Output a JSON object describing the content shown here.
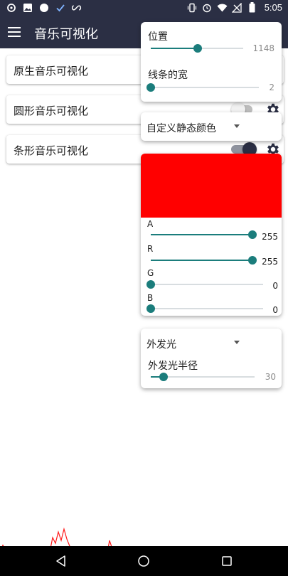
{
  "status_bar": {
    "time": "5:05",
    "left_icons": [
      "sync-icon",
      "image-icon",
      "circle-icon",
      "check-icon",
      "infinity-icon"
    ],
    "right_icons": [
      "vibrate-icon",
      "alarm-icon",
      "wifi-icon",
      "no-signal-icon",
      "battery-icon"
    ]
  },
  "app_bar": {
    "title": "音乐可视化",
    "menu_icon": "menu-icon",
    "background": "#2b2f44"
  },
  "options": [
    {
      "label": "原生音乐可视化"
    },
    {
      "label": "圆形音乐可视化",
      "switch_on": false
    },
    {
      "label": "条形音乐可视化",
      "switch_on": true
    }
  ],
  "bar_panel": {
    "position_label": "位置",
    "position_value": "1148",
    "position_fraction": 0.51,
    "width_label": "线条的宽",
    "width_value": "2",
    "width_fraction": 0.0
  },
  "color_panel": {
    "mode": "自定义静态颜色",
    "preview_color": "#ff0000",
    "channels": [
      {
        "label": "A",
        "value": "255",
        "fraction": 1.0
      },
      {
        "label": "R",
        "value": "255",
        "fraction": 1.0
      },
      {
        "label": "G",
        "value": "0",
        "fraction": 0.0
      },
      {
        "label": "B",
        "value": "0",
        "fraction": 0.0
      }
    ]
  },
  "glow_panel": {
    "mode": "外发光",
    "radius_label": "外发光半径",
    "radius_value": "30",
    "radius_fraction": 0.12
  },
  "accent_color": "#1b7d7c",
  "visualizer_color": "#ff1a1a",
  "nav_bar": {
    "icons": [
      "back-icon",
      "home-icon",
      "recents-icon"
    ]
  }
}
